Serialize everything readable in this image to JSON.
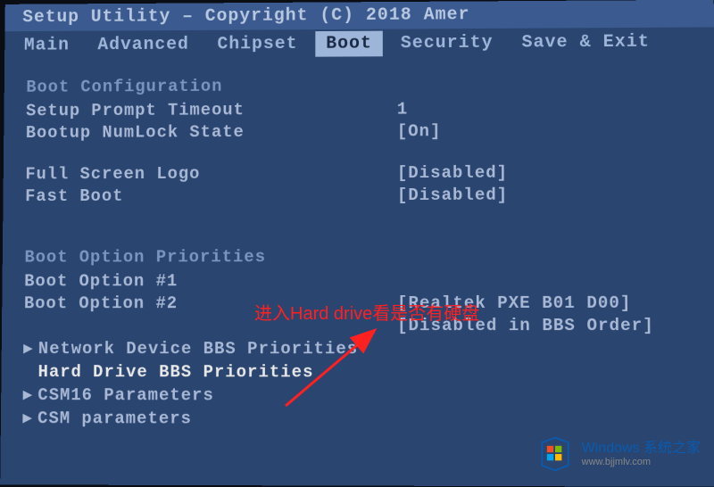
{
  "title_bar": "Setup Utility – Copyright (C) 2018 Amer",
  "menu": {
    "items": [
      "Main",
      "Advanced",
      "Chipset",
      "Boot",
      "Security",
      "Save & Exit"
    ],
    "active_index": 3
  },
  "sections": {
    "boot_config": {
      "header": "Boot Configuration",
      "settings": [
        {
          "label": "Setup Prompt Timeout",
          "value": "1"
        },
        {
          "label": "Bootup NumLock State",
          "value": "[On]"
        }
      ]
    },
    "display": {
      "settings": [
        {
          "label": "Full Screen Logo",
          "value": "[Disabled]"
        },
        {
          "label": "Fast Boot",
          "value": "[Disabled]"
        }
      ]
    },
    "boot_priorities": {
      "header": "Boot Option Priorities",
      "settings": [
        {
          "label": "Boot Option #1",
          "value": ""
        },
        {
          "label": "Boot Option #2",
          "value": "[Realtek PXE B01 D00]"
        },
        {
          "label": "",
          "value": "[Disabled in BBS Order]"
        }
      ]
    },
    "submenus": [
      {
        "label": "Network Device BBS Priorities",
        "selected": false
      },
      {
        "label": "Hard Drive BBS Priorities",
        "selected": true
      },
      {
        "label": "CSM16 Parameters",
        "selected": false
      },
      {
        "label": "CSM parameters",
        "selected": false
      }
    ]
  },
  "annotation": {
    "text": "进入Hard drive看是否有硬盘"
  },
  "watermark": {
    "title": "Windows 系统之家",
    "url": "www.bjjmlv.com"
  }
}
